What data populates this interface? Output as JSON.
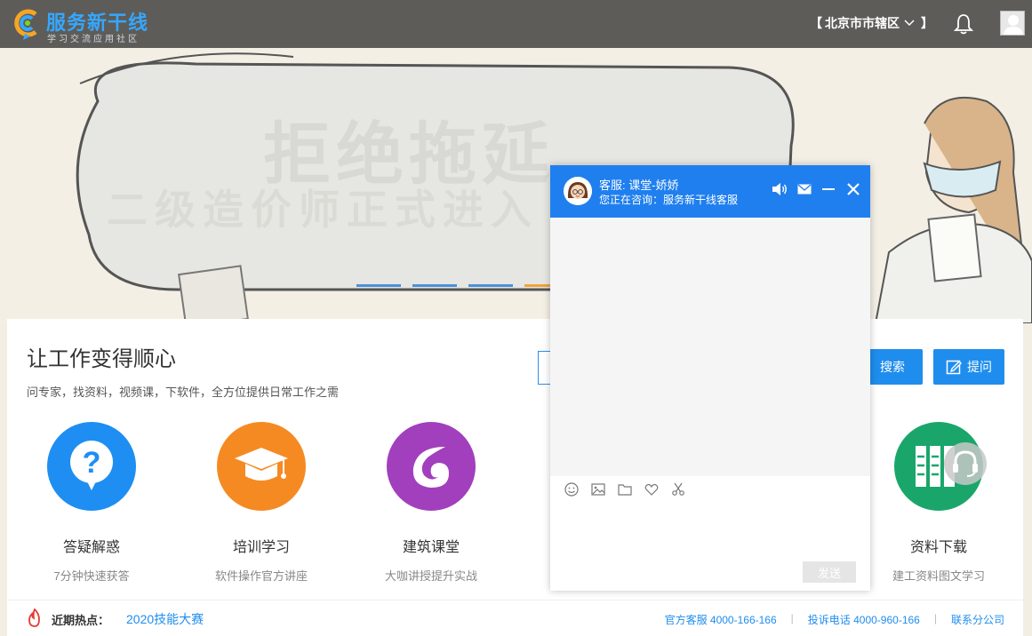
{
  "header": {
    "logo_title": "服务新干线",
    "logo_subtitle": "学习交流应用社区",
    "city_open": "【",
    "city": "北京市市辖区",
    "city_close": "】",
    "icons": [
      "bell-icon",
      "user-avatar-icon",
      "chevron-down-icon"
    ]
  },
  "banner": {
    "title": "拒绝拖延",
    "subtitle": "二级造价师正式进入",
    "slides": 5,
    "active_slide": 3,
    "colors": {
      "indicator": "#4a90d9",
      "indicator_active": "#f0a23a"
    }
  },
  "main": {
    "headline": "让工作变得顺心",
    "subline": "问专家，找资料，视频课，下软件，全方位提供日常工作之需",
    "search_button": "搜索",
    "ask_button": "提问",
    "features": [
      {
        "name": "答疑解惑",
        "desc": "7分钟快速获答",
        "icon": "question-icon",
        "color": "#1e8ef2"
      },
      {
        "name": "培训学习",
        "desc": "软件操作官方讲座",
        "icon": "graduation-cap-icon",
        "color": "#f58a22"
      },
      {
        "name": "建筑课堂",
        "desc": "大咖讲授提升实战",
        "icon": "swirl-icon",
        "color": "#a23fbd"
      },
      {
        "name": "资料下载",
        "desc": "建工资料图文学习",
        "icon": "books-icon",
        "color": "#1aa66a"
      }
    ]
  },
  "footer": {
    "hot_label": "近期热点：",
    "hot_link": "2020技能大赛",
    "contacts": [
      "官方客服 4000-166-166",
      "投诉电话 4000-960-166",
      "联系分公司"
    ],
    "separator": "|"
  },
  "chat": {
    "agent": "客服: 课堂-娇娇",
    "consulting": "您正在咨询：服务新干线客服",
    "send_label": "发送",
    "header_color": "#1f7fef",
    "tools": [
      "emoji-icon",
      "image-icon",
      "folder-icon",
      "heart-icon",
      "scissors-icon"
    ]
  }
}
